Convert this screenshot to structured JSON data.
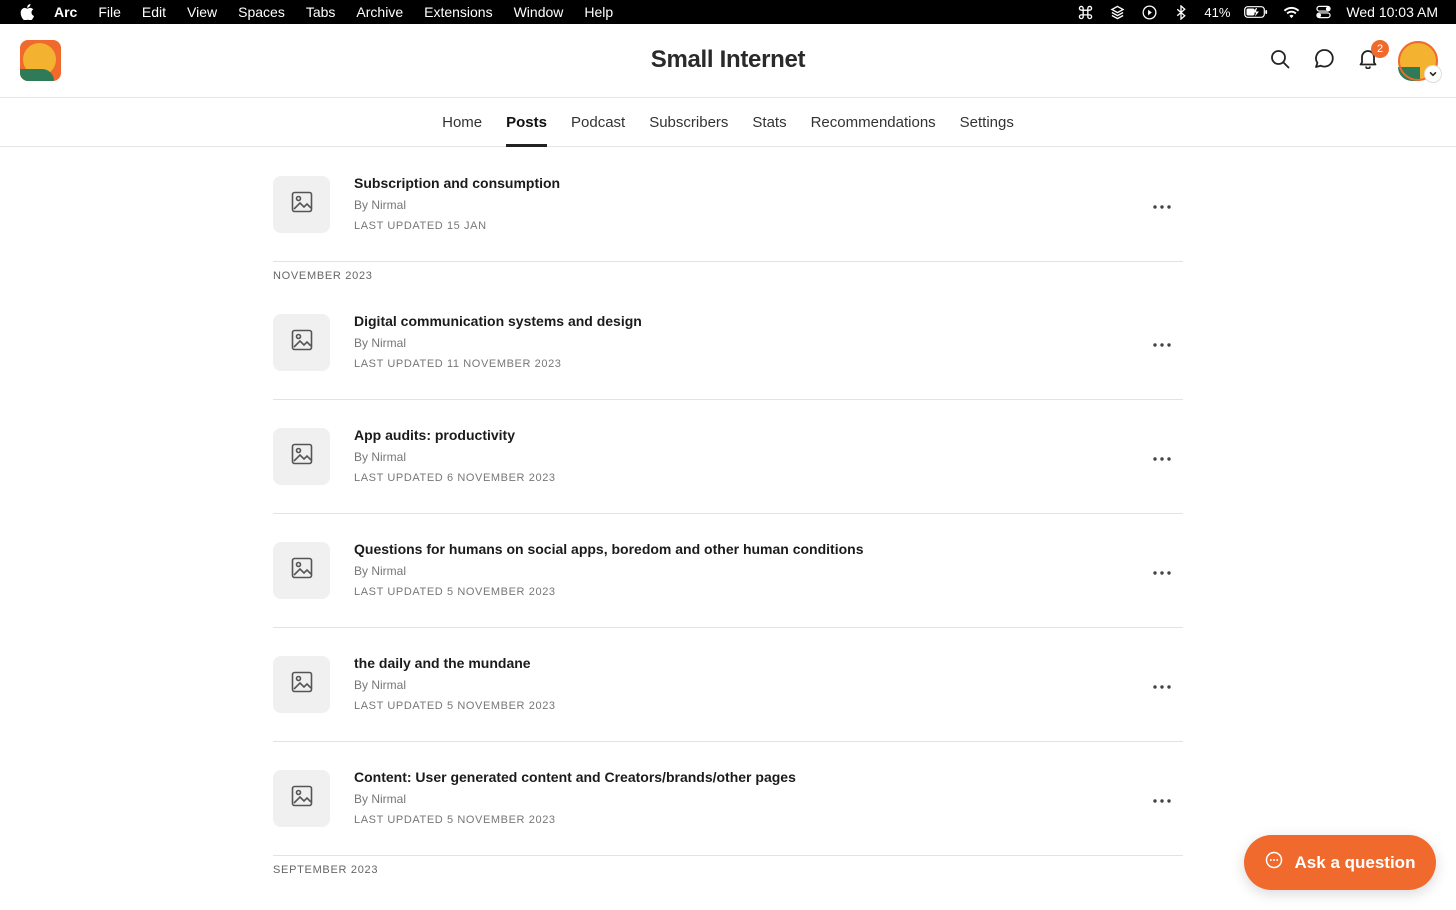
{
  "menubar": {
    "items": [
      "Arc",
      "File",
      "Edit",
      "View",
      "Spaces",
      "Tabs",
      "Archive",
      "Extensions",
      "Window",
      "Help"
    ],
    "battery": "41%",
    "clock": "Wed 10:03 AM"
  },
  "header": {
    "title": "Small Internet",
    "notification_count": "2"
  },
  "tabs": [
    {
      "label": "Home",
      "active": false
    },
    {
      "label": "Posts",
      "active": true
    },
    {
      "label": "Podcast",
      "active": false
    },
    {
      "label": "Subscribers",
      "active": false
    },
    {
      "label": "Stats",
      "active": false
    },
    {
      "label": "Recommendations",
      "active": false
    },
    {
      "label": "Settings",
      "active": false
    }
  ],
  "posts": {
    "top": {
      "title": "Subscription and consumption",
      "author": "By Nirmal",
      "updated": "LAST UPDATED 15 JAN"
    },
    "sections": [
      {
        "label": "NOVEMBER 2023",
        "items": [
          {
            "title": "Digital communication systems and design",
            "author": "By Nirmal",
            "updated": "LAST UPDATED 11 NOVEMBER 2023"
          },
          {
            "title": "App audits: productivity",
            "author": "By Nirmal",
            "updated": "LAST UPDATED 6 NOVEMBER 2023"
          },
          {
            "title": "Questions for humans on social apps, boredom and other human conditions",
            "author": "By Nirmal",
            "updated": "LAST UPDATED 5 NOVEMBER 2023"
          },
          {
            "title": "the daily and the mundane",
            "author": "By Nirmal",
            "updated": "LAST UPDATED 5 NOVEMBER 2023"
          },
          {
            "title": "Content: User generated content and Creators/brands/other pages",
            "author": "By Nirmal",
            "updated": "LAST UPDATED 5 NOVEMBER 2023"
          }
        ]
      },
      {
        "label": "SEPTEMBER 2023",
        "items": []
      }
    ]
  },
  "ask_button": {
    "label": "Ask a question"
  },
  "colors": {
    "accent": "#ef6a2c",
    "logo_yellow": "#f3b331",
    "logo_green": "#2f7a57"
  }
}
